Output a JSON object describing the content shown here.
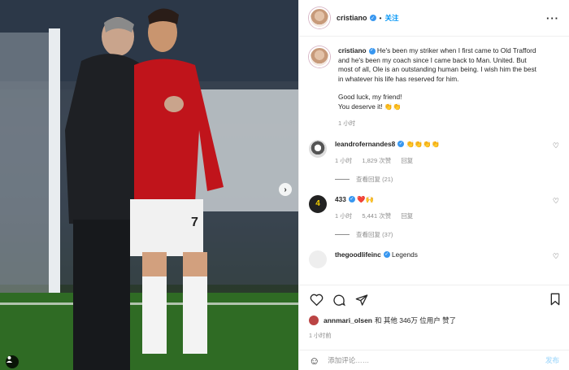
{
  "post": {
    "username": "cristiano",
    "follow_label": "关注",
    "more_label": "···",
    "caption_line1": "He's been my striker when I first came to Old Trafford",
    "caption_line2": "and he's been my coach since I came back to Man. United. But",
    "caption_line3": "most of all, Ole is an outstanding human being. I wish him the best",
    "caption_line4": "in whatever his life has reserved for him.",
    "caption_line5": "Good luck, my friend!",
    "caption_line6": "You deserve it! 👏👏",
    "caption_time": "1 小时"
  },
  "comments": [
    {
      "user": "leandrofernandes8",
      "text": "👏👏👏👏",
      "time": "1 小时",
      "likes": "1,829 次赞",
      "reply": "回复",
      "view_replies": "查看回复 (21)"
    },
    {
      "user": "433",
      "text": "❤️🙌",
      "time": "1 小时",
      "likes": "5,441 次赞",
      "reply": "回复",
      "view_replies": "查看回复 (37)"
    },
    {
      "user": "thegoodlifeinc",
      "text": "Legends"
    }
  ],
  "footer": {
    "liked_by_user": "annmari_olsen",
    "liked_by_rest": "和 其他 346万 位用户 赞了",
    "time": "1 小时前",
    "add_comment_placeholder": "添加评论……",
    "post_label": "发布"
  },
  "colors": {
    "accent": "#0095f6",
    "verified": "#3897f0",
    "muted": "#8e8e8e",
    "border": "#efefef"
  },
  "icons": [
    "heart-icon",
    "comment-icon",
    "share-icon",
    "bookmark-icon",
    "smile-icon",
    "chevron-right-icon",
    "user-tag-icon",
    "verified-icon"
  ]
}
